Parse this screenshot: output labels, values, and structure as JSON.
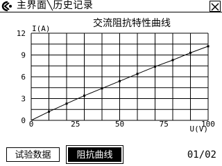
{
  "window": {
    "breadcrumb": "主界面╲历史记录",
    "logo_icon": "app-logo-icon",
    "close_icon": "close-x-icon"
  },
  "chart_data": {
    "type": "scatter",
    "title": "交流阻抗特性曲线",
    "xlabel": "U(V)",
    "ylabel": "I(A)",
    "xlim": [
      0,
      100
    ],
    "ylim": [
      0,
      12
    ],
    "x_ticks": [
      "0",
      "25",
      "50",
      "75",
      "100"
    ],
    "y_ticks": [
      "12",
      "9",
      "6",
      "3",
      "0"
    ],
    "grid": true,
    "series": [
      {
        "x": [
          10,
          20,
          30,
          40,
          50,
          60,
          70,
          80,
          90,
          100
        ],
        "y": [
          1.2,
          2.3,
          3.4,
          4.4,
          5.4,
          6.4,
          7.4,
          8.3,
          9.3,
          10.2
        ],
        "line": true,
        "markers": true
      }
    ]
  },
  "buttons": {
    "test_data": "试验数据",
    "impedance_curve": "阻抗曲线"
  },
  "pager": {
    "label": "01/02"
  }
}
